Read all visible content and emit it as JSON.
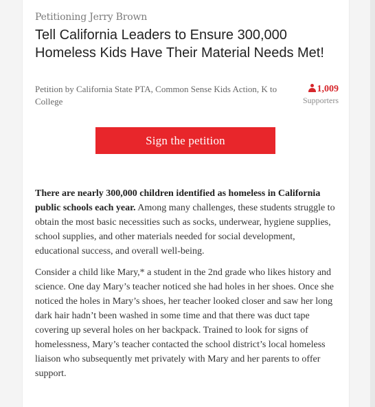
{
  "petition": {
    "petitioning_text": "Petitioning Jerry Brown",
    "title": "Tell California Leaders to Ensure 300,000 Homeless Kids Have Their Material Needs Met!",
    "byline": "Petition by California State PTA, Common Sense Kids Action, K to College",
    "supporters_count": "1,009",
    "supporters_label": "Supporters",
    "sign_button_label": "Sign the petition",
    "accent_color": "#e8262b",
    "icon": "person-icon"
  },
  "body": {
    "paragraph1_bold": "There are nearly 300,000 children identified as homeless in California public schools each year.",
    "paragraph1_rest": " Among many challenges, these students struggle to obtain the most basic necessities such as socks, underwear, hygiene supplies, school supplies, and other materials needed for social development, educational success, and overall well-being.",
    "paragraph2": "Consider a child like Mary,* a student in the 2nd grade who likes history and science. One day Mary’s teacher noticed she had holes in her shoes. Once she noticed the holes in Mary’s shoes, her teacher looked closer and saw her long dark hair hadn’t been washed in some time and that there was duct tape covering up several holes on her backpack. Trained to look for signs of homelessness, Mary’s teacher contacted the school district’s local homeless liaison who subsequently met privately with Mary and her parents to offer support."
  }
}
